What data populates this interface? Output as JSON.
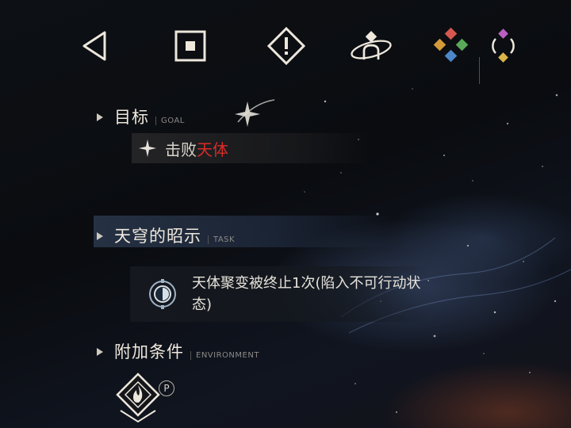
{
  "toolbar": {
    "icons": [
      "back-icon",
      "stop-icon",
      "alert-icon",
      "orbit-character-icon",
      "element-cluster-icon",
      "element-cycle-icon"
    ]
  },
  "goal": {
    "title": "目标",
    "subtitle": "GOAL",
    "item_prefix": "击败",
    "item_highlight": "天体",
    "highlight_color": "#d92c26"
  },
  "task": {
    "title": "天穹的昭示",
    "subtitle": "TASK",
    "description": "天体聚变被终止1次(陷入不可行动状态)"
  },
  "environment": {
    "title": "附加条件",
    "subtitle": "ENVIRONMENT",
    "badge": "P"
  }
}
